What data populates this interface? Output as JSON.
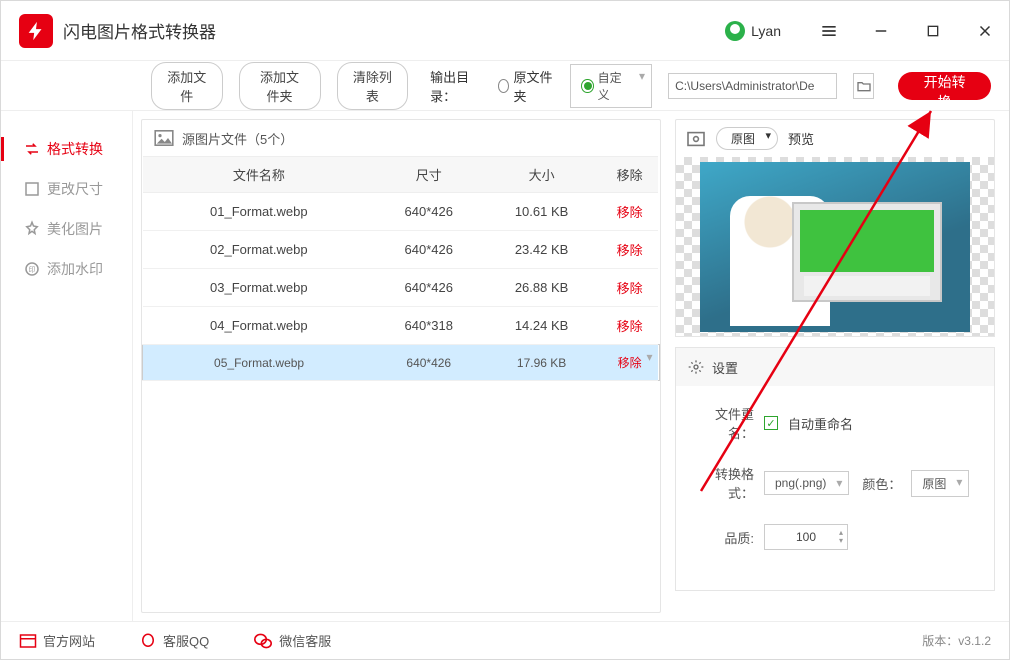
{
  "title": "闪电图片格式转换器",
  "user": "Lyan",
  "toolbar": {
    "add_file": "添加文件",
    "add_folder": "添加文件夹",
    "clear_list": "清除列表",
    "output_label": "输出目录：",
    "radio_original": "原文件夹",
    "radio_custom": "自定义",
    "path": "C:\\Users\\Administrator\\De",
    "start": "开始转换"
  },
  "sidebar": {
    "items": [
      {
        "label": "格式转换"
      },
      {
        "label": "更改尺寸"
      },
      {
        "label": "美化图片"
      },
      {
        "label": "添加水印"
      }
    ]
  },
  "filepanel": {
    "title": "源图片文件（5个）",
    "cols": {
      "name": "文件名称",
      "size": "尺寸",
      "bytes": "大小",
      "remove": "移除"
    },
    "remove_label": "移除",
    "rows": [
      {
        "name": "01_Format.webp",
        "size": "640*426",
        "bytes": "10.61 KB"
      },
      {
        "name": "02_Format.webp",
        "size": "640*426",
        "bytes": "23.42 KB"
      },
      {
        "name": "03_Format.webp",
        "size": "640*426",
        "bytes": "26.88 KB"
      },
      {
        "name": "04_Format.webp",
        "size": "640*318",
        "bytes": "14.24 KB"
      },
      {
        "name": "05_Format.webp",
        "size": "640*426",
        "bytes": "17.96 KB"
      }
    ]
  },
  "preview": {
    "zoom": "原图",
    "label": "预览"
  },
  "settings": {
    "title": "设置",
    "rename_label": "文件重名：",
    "rename_value": "自动重命名",
    "format_label": "转换格式：",
    "format_value": "png(.png)",
    "color_label": "颜色：",
    "color_value": "原图",
    "quality_label": "品质:",
    "quality_value": "100"
  },
  "footer": {
    "site": "官方网站",
    "qq": "客服QQ",
    "wechat": "微信客服",
    "version_label": "版本：",
    "version": "v3.1.2"
  }
}
